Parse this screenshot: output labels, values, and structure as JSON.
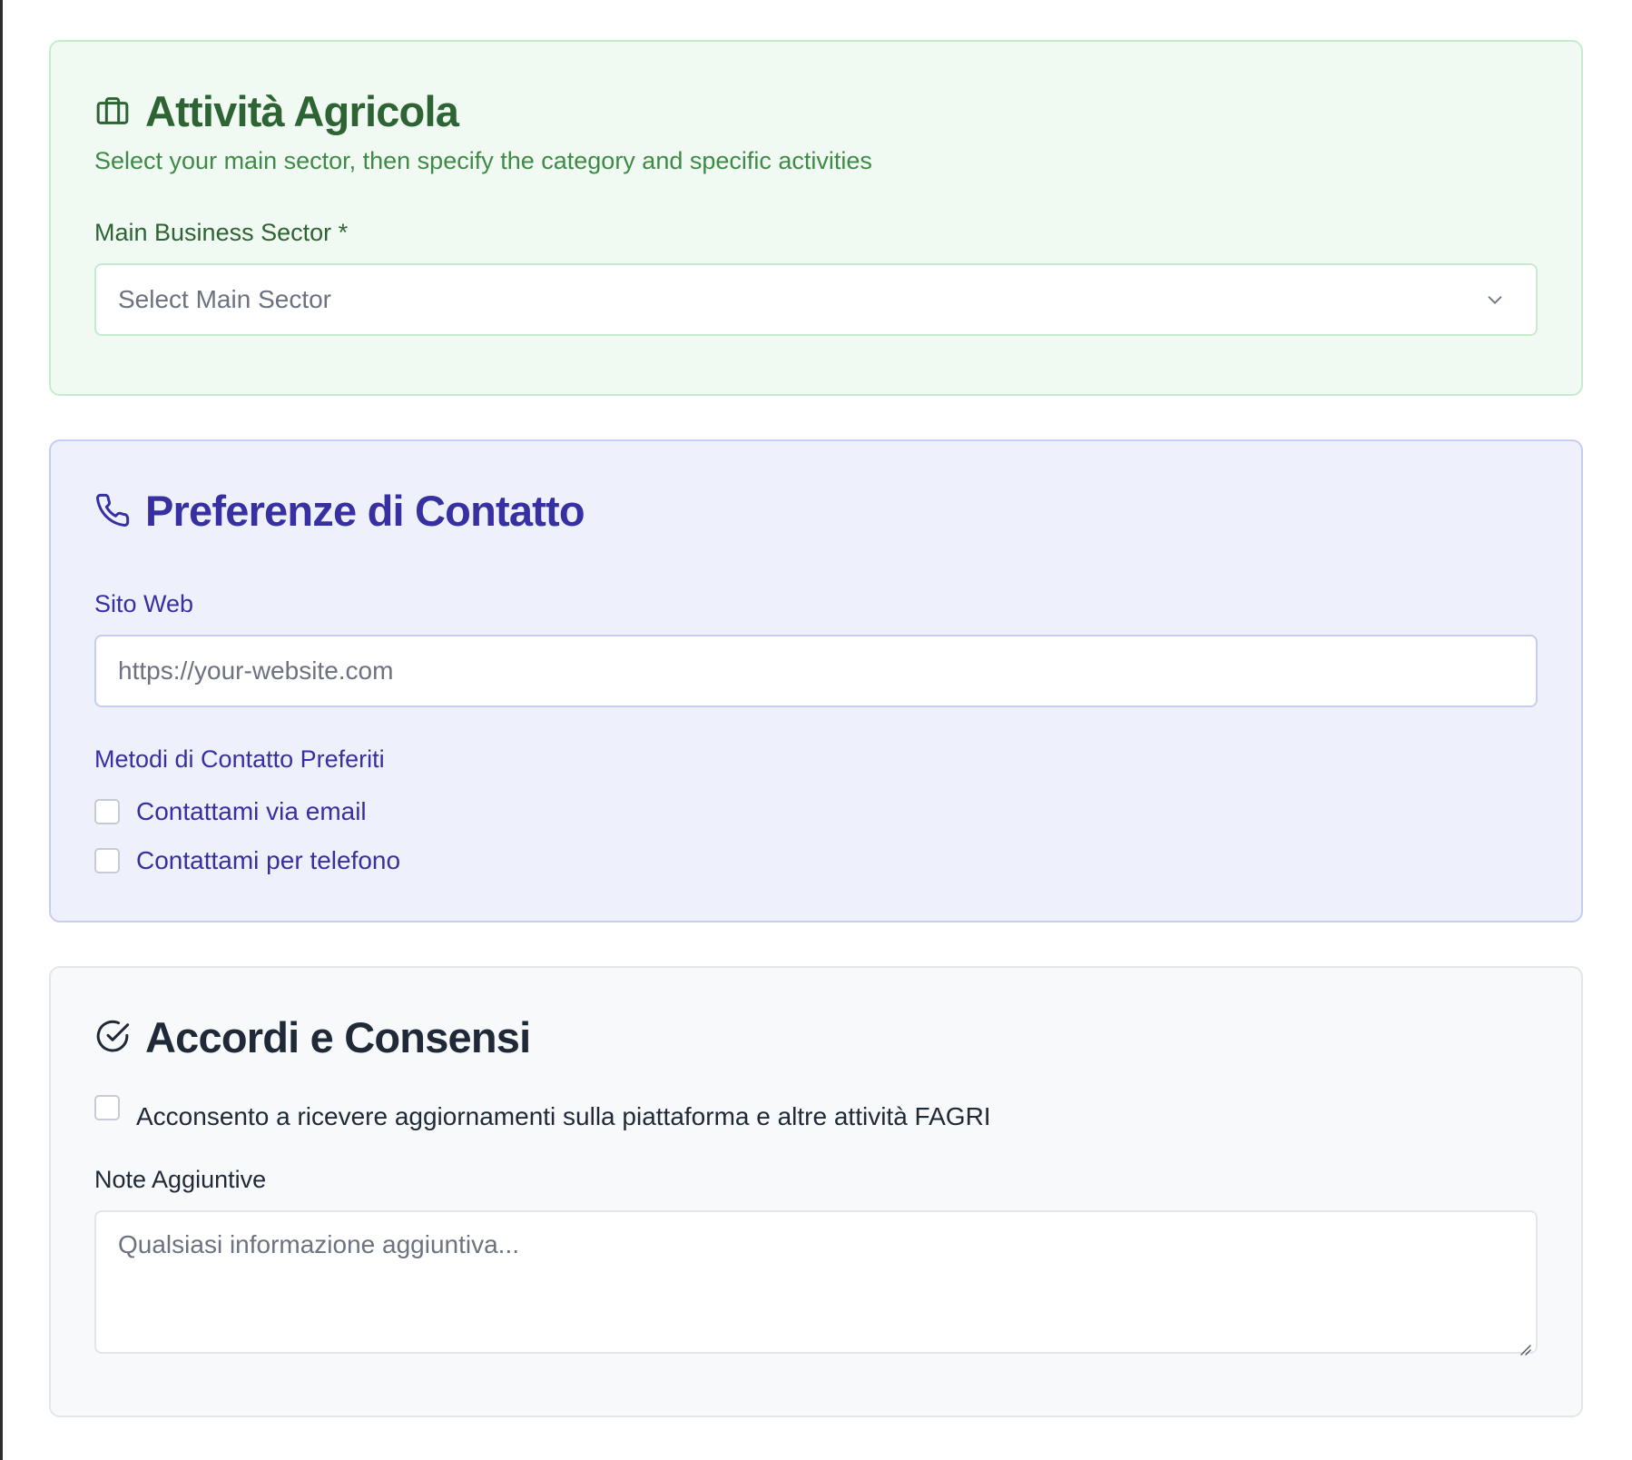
{
  "agricultural_activity": {
    "title": "Attività Agricola",
    "icon": "briefcase-icon",
    "subtitle": "Select your main sector, then specify the category and specific activities",
    "sector_label": "Main Business Sector *",
    "sector_select": {
      "selected": "Select Main Sector",
      "icon": "chevron-down-icon"
    }
  },
  "contact_preferences": {
    "title": "Preferenze di Contatto",
    "icon": "phone-icon",
    "website_label": "Sito Web",
    "website_placeholder": "https://your-website.com",
    "methods_label": "Metodi di Contatto Preferiti",
    "methods": [
      {
        "label": "Contattami via email",
        "checked": false
      },
      {
        "label": "Contattami per telefono",
        "checked": false
      }
    ]
  },
  "agreements": {
    "title": "Accordi e Consensi",
    "icon": "check-circle-icon",
    "consent_label": "Acconsento a ricevere aggiornamenti sulla piattaforma e altre attività FAGRI",
    "consent_checked": false,
    "notes_label": "Note Aggiuntive",
    "notes_placeholder": "Qualsiasi informazione aggiuntiva..."
  },
  "colors": {
    "green_bg": "#f0faf2",
    "green_text": "#2e6434",
    "blue_bg": "#eef1fc",
    "blue_text": "#3730a3",
    "gray_bg": "#f8f9fb",
    "gray_text": "#1f2937"
  }
}
